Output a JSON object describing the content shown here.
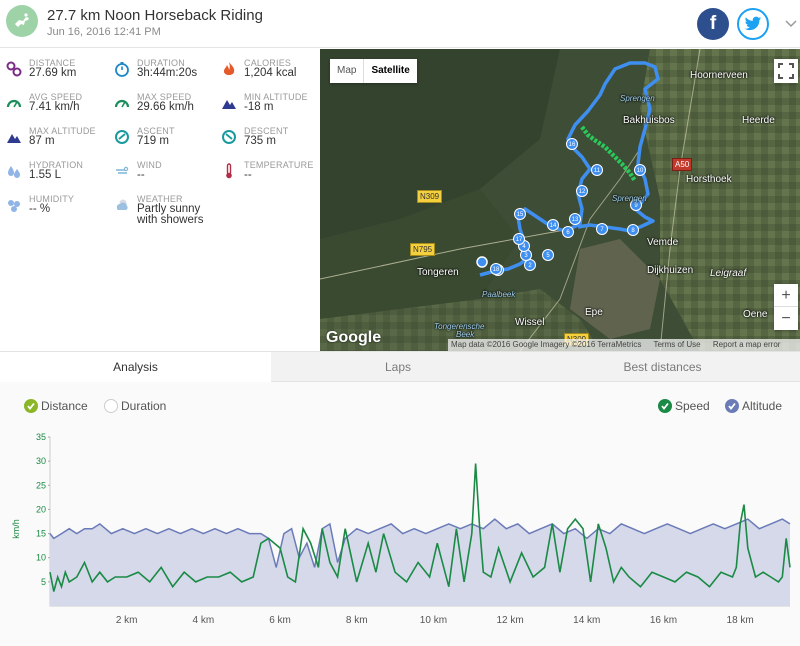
{
  "header": {
    "title": "27.7 km Noon Horseback Riding",
    "date": "Jun 16, 2016 12:41 PM",
    "facebook_letter": "f"
  },
  "stats": [
    {
      "label": "Distance",
      "value": "27.69 km",
      "icon": "distance-icon",
      "color": "#7a2d87"
    },
    {
      "label": "Duration",
      "value": "3h:44m:20s",
      "icon": "stopwatch-icon",
      "color": "#1e88c7"
    },
    {
      "label": "Calories",
      "value": "1,204 kcal",
      "icon": "flame-icon",
      "color": "#e55a2b"
    },
    {
      "label": "Avg speed",
      "value": "7.41 km/h",
      "icon": "speedometer-icon",
      "color": "#1a8f5a"
    },
    {
      "label": "Max speed",
      "value": "29.66 km/h",
      "icon": "speedometer-icon",
      "color": "#1a8f5a"
    },
    {
      "label": "Min altitude",
      "value": "-18 m",
      "icon": "mountain-icon",
      "color": "#2f3b8e"
    },
    {
      "label": "Max altitude",
      "value": "87 m",
      "icon": "mountain-icon",
      "color": "#2f3b8e"
    },
    {
      "label": "Ascent",
      "value": "719 m",
      "icon": "ascent-icon",
      "color": "#1a9aa0"
    },
    {
      "label": "Descent",
      "value": "735 m",
      "icon": "descent-icon",
      "color": "#1a9aa0"
    },
    {
      "label": "Hydration",
      "value": "1.55 L",
      "icon": "water-drops-icon",
      "color": "#8fb4e6"
    },
    {
      "label": "Wind",
      "value": "--",
      "icon": "wind-icon",
      "color": "#7fb6d8"
    },
    {
      "label": "Temperature",
      "value": "--",
      "icon": "thermometer-icon",
      "color": "#b22d4a"
    },
    {
      "label": "Humidity",
      "value": "-- %",
      "icon": "humidity-icon",
      "color": "#8fb4e6"
    },
    {
      "label": "Weather",
      "value": "Partly sunny with showers",
      "value_line1": "Partly sunny",
      "value_line2": "with showers",
      "icon": "weather-icon",
      "color": "#9cc0e0"
    }
  ],
  "map": {
    "toggle_map": "Map",
    "toggle_satellite": "Satellite",
    "zoom_in": "+",
    "zoom_out": "−",
    "google_logo": "Google",
    "attribution": [
      "Map data ©2016 Google Imagery ©2016 TerraMetrics",
      "Terms of Use",
      "Report a map error"
    ],
    "labels": [
      {
        "text": "Hoornerveen",
        "kind": "place"
      },
      {
        "text": "Heerde",
        "kind": "place"
      },
      {
        "text": "Bakhuisbos",
        "kind": "place"
      },
      {
        "text": "Horsthoek",
        "kind": "place"
      },
      {
        "text": "Vemde",
        "kind": "place"
      },
      {
        "text": "Dijkhuizen",
        "kind": "place"
      },
      {
        "text": "Leigraaf",
        "kind": "town"
      },
      {
        "text": "Tongeren",
        "kind": "place"
      },
      {
        "text": "Wissel",
        "kind": "place"
      },
      {
        "text": "Epe",
        "kind": "place"
      },
      {
        "text": "Oene",
        "kind": "place"
      },
      {
        "text": "Sprengen",
        "kind": "water"
      },
      {
        "text": "Sprengen",
        "kind": "water"
      },
      {
        "text": "Paalbeek",
        "kind": "water"
      },
      {
        "text": "Tongerensche",
        "kind": "water"
      },
      {
        "text": "Beek",
        "kind": "water"
      }
    ],
    "road_signs": [
      {
        "text": "N309",
        "kind": "yellow"
      },
      {
        "text": "N795",
        "kind": "yellow"
      },
      {
        "text": "A50",
        "kind": "red"
      },
      {
        "text": "N309",
        "kind": "yellow"
      }
    ],
    "markers": [
      "1",
      "2",
      "3",
      "4",
      "5",
      "6",
      "7",
      "8",
      "9",
      "10",
      "11",
      "12",
      "13",
      "14",
      "15",
      "16",
      "17",
      "18"
    ]
  },
  "tabs": [
    "Analysis",
    "Laps",
    "Best distances"
  ],
  "legend": {
    "distance": "Distance",
    "duration": "Duration",
    "speed": "Speed",
    "altitude": "Altitude"
  },
  "colors": {
    "speed": "#1a8a45",
    "altitude": "#6b7bb8",
    "altitude_fill": "#d5d9ea",
    "route": "#4a90e2",
    "route_highlight": "#2ecc71",
    "distance_check": "#8ab628"
  },
  "chart_data": {
    "type": "line",
    "title": "",
    "xlabel": "",
    "ylabel": "km/h",
    "x_ticks": [
      "2 km",
      "4 km",
      "6 km",
      "8 km",
      "10 km",
      "12 km",
      "14 km",
      "16 km",
      "18 km"
    ],
    "y_ticks": [
      5,
      10,
      15,
      20,
      25,
      30,
      35
    ],
    "xlim": [
      0,
      19.3
    ],
    "ylim": [
      0,
      35
    ],
    "grid": false,
    "series": [
      {
        "name": "Speed",
        "x": [
          0,
          0.1,
          0.2,
          0.3,
          0.4,
          0.5,
          0.7,
          0.9,
          1.1,
          1.3,
          1.5,
          1.7,
          2.0,
          2.3,
          2.6,
          2.9,
          3.2,
          3.5,
          3.8,
          4.1,
          4.4,
          4.7,
          5.0,
          5.3,
          5.5,
          5.7,
          6.0,
          6.2,
          6.4,
          6.6,
          6.8,
          7.0,
          7.1,
          7.3,
          7.5,
          7.7,
          8.0,
          8.3,
          8.5,
          8.7,
          9.0,
          9.3,
          9.6,
          9.9,
          10.1,
          10.4,
          10.6,
          10.8,
          10.9,
          11.0,
          11.1,
          11.2,
          11.3,
          11.5,
          11.7,
          12.0,
          12.3,
          12.6,
          12.9,
          13.1,
          13.3,
          13.5,
          13.7,
          13.9,
          14.1,
          14.3,
          14.5,
          14.7,
          14.9,
          15.1,
          15.4,
          15.7,
          16.0,
          16.3,
          16.6,
          16.9,
          17.2,
          17.5,
          17.8,
          17.9,
          18.0,
          18.1,
          18.2,
          18.4,
          18.6,
          18.8,
          19.0,
          19.1,
          19.2,
          19.3
        ],
        "y": [
          7,
          3,
          6,
          4,
          7,
          5,
          6,
          9,
          5,
          7,
          5,
          6,
          6,
          7,
          5,
          8,
          4,
          7,
          5,
          6,
          6,
          7,
          5,
          6,
          13,
          14,
          12,
          6,
          5,
          16,
          13,
          8,
          16,
          9,
          6,
          16,
          5,
          13,
          7,
          15,
          7,
          5,
          9,
          6,
          13,
          4,
          16,
          5,
          10,
          15,
          29.5,
          17,
          7,
          6,
          12,
          5,
          11,
          6,
          8,
          17,
          7,
          16,
          18,
          16,
          5,
          17,
          12,
          5,
          8,
          6,
          4,
          7,
          6,
          5,
          7,
          6,
          4,
          7,
          6,
          8,
          17,
          21,
          12,
          6,
          7,
          6,
          5,
          6,
          14,
          8
        ]
      },
      {
        "name": "Altitude",
        "x": [
          0,
          0.1,
          0.3,
          0.5,
          0.7,
          0.9,
          1.1,
          1.3,
          1.6,
          1.9,
          2.2,
          2.5,
          2.8,
          3.1,
          3.4,
          3.7,
          4.0,
          4.3,
          4.6,
          4.9,
          5.2,
          5.5,
          5.7,
          5.9,
          6.1,
          6.3,
          6.5,
          6.7,
          6.9,
          7.1,
          7.3,
          7.5,
          7.7,
          8.0,
          8.3,
          8.6,
          8.9,
          9.2,
          9.5,
          9.8,
          10.1,
          10.4,
          10.7,
          11.0,
          11.3,
          11.6,
          11.9,
          12.2,
          12.5,
          12.8,
          13.1,
          13.4,
          13.7,
          14.0,
          14.3,
          14.6,
          14.9,
          15.2,
          15.5,
          15.8,
          16.1,
          16.4,
          16.7,
          17.0,
          17.3,
          17.6,
          17.9,
          18.2,
          18.5,
          18.8,
          19.1,
          19.3
        ],
        "y": [
          15,
          14,
          15,
          16,
          15,
          16,
          16,
          17,
          15,
          16,
          15,
          16,
          15,
          16,
          15,
          16,
          15,
          16,
          15,
          16,
          15,
          15,
          14,
          8,
          15,
          16,
          10,
          13,
          8,
          16,
          17,
          9,
          14,
          16,
          15,
          16,
          17,
          15,
          16,
          15,
          16,
          17,
          16,
          17,
          16,
          18,
          16,
          17,
          15,
          16,
          17,
          15,
          16,
          14,
          16,
          15,
          17,
          16,
          15,
          16,
          17,
          16,
          15,
          16,
          17,
          16,
          17,
          18,
          16,
          17,
          18,
          17
        ]
      }
    ]
  }
}
